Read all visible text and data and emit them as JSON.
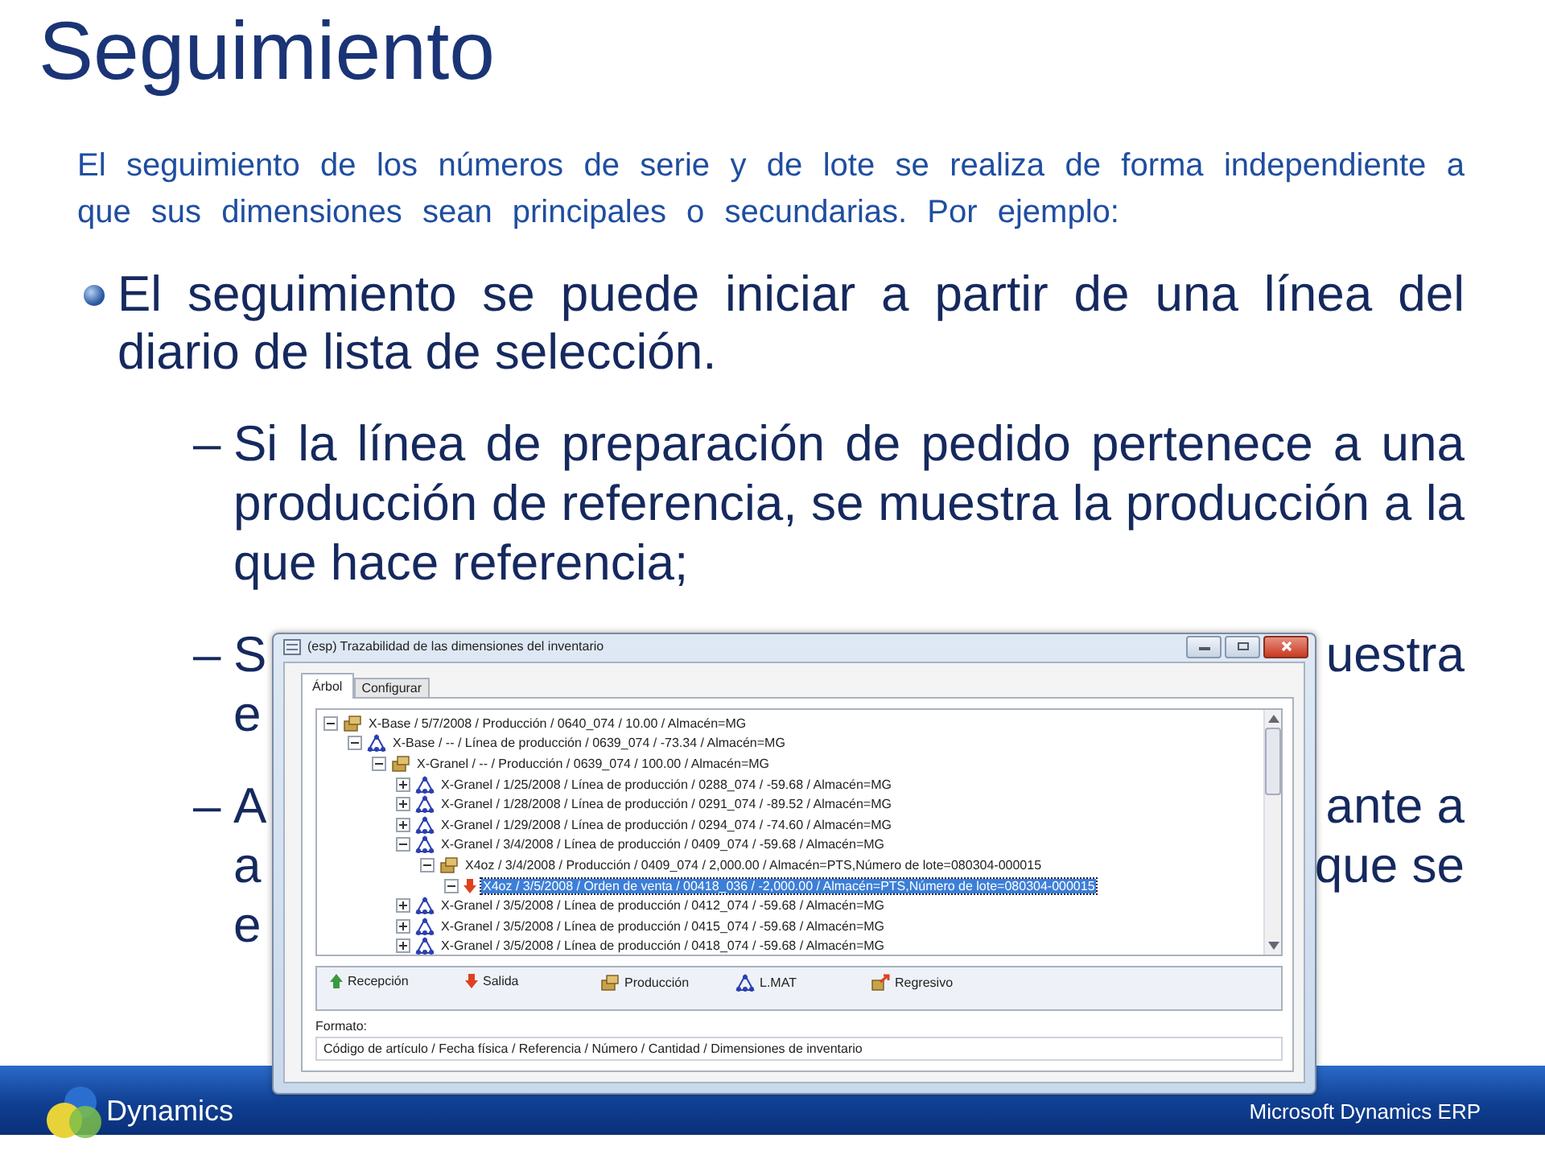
{
  "slide": {
    "title": "Seguimiento",
    "intro": "El seguimiento de los números de serie y de lote se realiza de forma independiente a que sus dimensiones sean principales o secundarias. Por ejemplo:",
    "bullet": "El seguimiento se puede iniciar a partir de una línea del diario de lista de selección.",
    "sub_bullets": [
      {
        "marker": "–",
        "lines": [
          {
            "left": "Si la línea de preparación de pedido pertenece a una producción de referencia, se muestra la producción a la que hace referencia;"
          }
        ]
      },
      {
        "marker": "–",
        "lines": [
          {
            "left": "S",
            "right": "uestra"
          },
          {
            "left": "e"
          }
        ]
      },
      {
        "marker": "–",
        "lines": [
          {
            "left": "A",
            "right": "ante a"
          },
          {
            "left": "a",
            "right": "que se"
          },
          {
            "left": "e"
          }
        ]
      }
    ]
  },
  "footer": {
    "brand": "Dynamics",
    "product": "Microsoft Dynamics ERP"
  },
  "window": {
    "title": "(esp) Trazabilidad de las dimensiones del inventario",
    "tabs": [
      {
        "label": "Árbol",
        "selected": true
      },
      {
        "label": "Configurar",
        "selected": false
      }
    ],
    "tree": [
      {
        "kind": "produccion",
        "text": "X-Base / 5/7/2008 / Producción / 0640_074 / 10.00 / Almacén=MG",
        "expanded": true,
        "selected": false,
        "children": [
          {
            "kind": "linea",
            "text": "X-Base / -- / Línea de producción / 0639_074 / -73.34 / Almacén=MG",
            "expanded": true,
            "selected": false,
            "children": [
              {
                "kind": "produccion",
                "text": "X-Granel / -- / Producción / 0639_074 / 100.00 / Almacén=MG",
                "expanded": true,
                "selected": false,
                "children": [
                  {
                    "kind": "linea",
                    "text": "X-Granel / 1/25/2008 / Línea de producción / 0288_074 / -59.68 / Almacén=MG",
                    "expanded": false,
                    "selected": false
                  },
                  {
                    "kind": "linea",
                    "text": "X-Granel / 1/28/2008 / Línea de producción / 0291_074 / -89.52 / Almacén=MG",
                    "expanded": false,
                    "selected": false
                  },
                  {
                    "kind": "linea",
                    "text": "X-Granel / 1/29/2008 / Línea de producción / 0294_074 / -74.60 / Almacén=MG",
                    "expanded": false,
                    "selected": false
                  },
                  {
                    "kind": "linea",
                    "text": "X-Granel / 3/4/2008 / Línea de producción / 0409_074 / -59.68 / Almacén=MG",
                    "expanded": true,
                    "selected": false,
                    "children": [
                      {
                        "kind": "produccion",
                        "text": "X4oz / 3/4/2008 / Producción / 0409_074 / 2,000.00 / Almacén=PTS,Número de lote=080304-000015",
                        "expanded": true,
                        "selected": false,
                        "children": [
                          {
                            "kind": "salida",
                            "text": "X4oz / 3/5/2008 / Orden de venta / 00418_036 / -2,000.00 / Almacén=PTS,Número de lote=080304-000015",
                            "expanded": true,
                            "selected": true
                          }
                        ]
                      }
                    ]
                  },
                  {
                    "kind": "linea",
                    "text": "X-Granel / 3/5/2008 / Línea de producción / 0412_074 / -59.68 / Almacén=MG",
                    "expanded": false,
                    "selected": false
                  },
                  {
                    "kind": "linea",
                    "text": "X-Granel / 3/5/2008 / Línea de producción / 0415_074 / -59.68 / Almacén=MG",
                    "expanded": false,
                    "selected": false
                  },
                  {
                    "kind": "linea",
                    "text": "X-Granel / 3/5/2008 / Línea de producción / 0418_074 / -59.68 / Almacén=MG",
                    "expanded": false,
                    "selected": false
                  }
                ]
              }
            ]
          }
        ]
      }
    ],
    "legend": [
      {
        "kind": "recepcion",
        "label": "Recepción"
      },
      {
        "kind": "salida",
        "label": "Salida"
      },
      {
        "kind": "produccion",
        "label": "Producción"
      },
      {
        "kind": "linea",
        "label": "L.MAT"
      },
      {
        "kind": "regresivo",
        "label": "Regresivo"
      }
    ],
    "format_label": "Formato:",
    "format_value": "Código de artículo / Fecha física / Referencia / Número / Cantidad / Dimensiones de inventario"
  }
}
